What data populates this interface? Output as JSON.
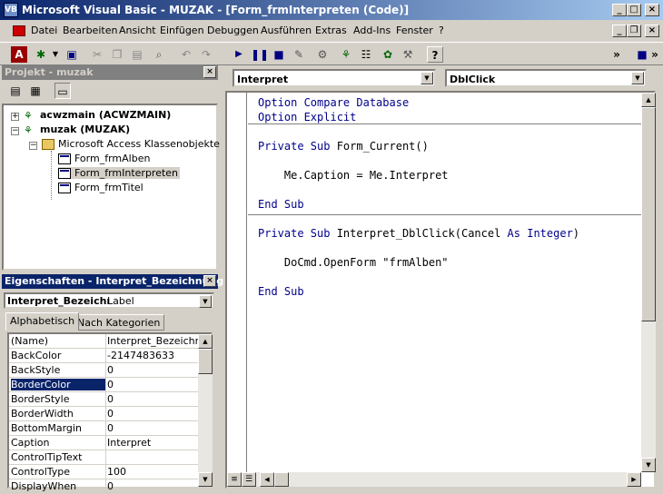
{
  "window": {
    "title": "Microsoft Visual Basic - MUZAK - [Form_frmInterpreten (Code)]",
    "app_icon": "vb-icon",
    "caption_buttons": [
      "_",
      "□",
      "×"
    ]
  },
  "menu": {
    "items": [
      "Datei",
      "Bearbeiten",
      "Ansicht",
      "Einfügen",
      "Debuggen",
      "Ausführen",
      "Extras",
      "Add-Ins",
      "Fenster",
      "?"
    ]
  },
  "toolbar": {
    "buttons": [
      "access-icon",
      "insert-module-icon",
      "save-icon",
      "cut-icon",
      "copy-icon",
      "paste-icon",
      "find-icon",
      "undo-icon",
      "redo-icon",
      "run-icon",
      "break-icon",
      "reset-icon",
      "design-mode-icon",
      "project-explorer-icon",
      "properties-icon",
      "object-browser-icon",
      "toolbox-icon",
      "help-icon"
    ]
  },
  "project": {
    "title": "Projekt - muzak",
    "tree": [
      {
        "label": "acwzmain (ACWZMAIN)",
        "level": 0,
        "bold": true
      },
      {
        "label": "muzak (MUZAK)",
        "level": 0,
        "bold": true
      },
      {
        "label": "Microsoft Access Klassenobjekte",
        "level": 1,
        "bold": false
      },
      {
        "label": "Form_frmAlben",
        "level": 2,
        "bold": false
      },
      {
        "label": "Form_frmInterpreten",
        "level": 2,
        "bold": false,
        "selected": true
      },
      {
        "label": "Form_frmTitel",
        "level": 2,
        "bold": false
      }
    ]
  },
  "properties": {
    "title": "Eigenschaften - Interpret_Bezeichnung",
    "object_name": "Interpret_Bezeichı",
    "object_type": "Label",
    "tabs": [
      "Alphabetisch",
      "Nach Kategorien"
    ],
    "rows": [
      {
        "name": "(Name)",
        "value": "Interpret_Bezeichnu"
      },
      {
        "name": "BackColor",
        "value": "-2147483633"
      },
      {
        "name": "BackStyle",
        "value": "0"
      },
      {
        "name": "BorderColor",
        "value": "0",
        "selected": true
      },
      {
        "name": "BorderStyle",
        "value": "0"
      },
      {
        "name": "BorderWidth",
        "value": "0"
      },
      {
        "name": "BottomMargin",
        "value": "0"
      },
      {
        "name": "Caption",
        "value": "Interpret"
      },
      {
        "name": "ControlTipText",
        "value": ""
      },
      {
        "name": "ControlType",
        "value": "100"
      },
      {
        "name": "DisplayWhen",
        "value": "0"
      }
    ]
  },
  "code": {
    "object_combo": "Interpret",
    "procedure_combo": "DblClick",
    "lines": [
      [
        [
          "kw",
          "Option Compare Database"
        ]
      ],
      [
        [
          "kw",
          "Option Explicit"
        ]
      ],
      [],
      [
        [
          "kw",
          "Private Sub "
        ],
        [
          "t",
          "Form_Current()"
        ]
      ],
      [],
      [
        [
          "t",
          "    Me.Caption = Me.Interpret"
        ]
      ],
      [],
      [
        [
          "kw",
          "End Sub"
        ]
      ],
      [],
      [
        [
          "kw",
          "Private Sub "
        ],
        [
          "t",
          "Interpret_DblClick(Cancel "
        ],
        [
          "kw",
          "As Integer"
        ],
        [
          "t",
          ")"
        ]
      ],
      [],
      [
        [
          "t",
          "    DoCmd.OpenForm \"frmAlben\""
        ]
      ],
      [],
      [
        [
          "kw",
          "End Sub"
        ]
      ]
    ]
  }
}
